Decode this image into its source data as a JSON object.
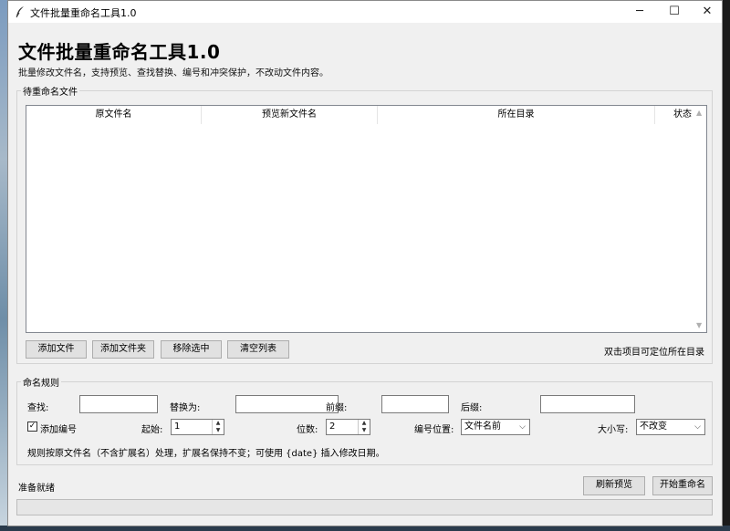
{
  "window": {
    "title": "文件批量重命名工具1.0",
    "controls": {
      "minimize": "─",
      "maximize": "☐",
      "close": "✕"
    }
  },
  "header": {
    "title": "文件批量重命名工具1.0",
    "subtitle": "批量修改文件名，支持预览、查找替换、编号和冲突保护，不改动文件内容。"
  },
  "files_group": {
    "label": "待重命名文件",
    "columns": [
      "原文件名",
      "预览新文件名",
      "所在目录",
      "状态"
    ],
    "rows": [],
    "buttons": [
      "添加文件",
      "添加文件夹",
      "移除选中",
      "清空列表"
    ],
    "hint": "双击项目可定位所在目录"
  },
  "rules_group": {
    "label": "命名规则",
    "find_label": "查找:",
    "find_value": "",
    "replace_label": "替换为:",
    "replace_value": "",
    "prefix_label": "前缀:",
    "prefix_value": "",
    "suffix_label": "后缀:",
    "suffix_value": "",
    "numbering_label": "添加编号",
    "numbering_checked": true,
    "start_label": "起始:",
    "start_value": "1",
    "digits_label": "位数:",
    "digits_value": "2",
    "position_label": "编号位置:",
    "position_value": "文件名前",
    "case_label": "大小写:",
    "case_value": "不改变",
    "note": "规则按原文件名（不含扩展名）处理，扩展名保持不变；可使用 {date} 插入修改日期。"
  },
  "footer": {
    "status": "准备就绪",
    "refresh_button": "刷新预览",
    "start_button": "开始重命名",
    "progress": 0
  }
}
